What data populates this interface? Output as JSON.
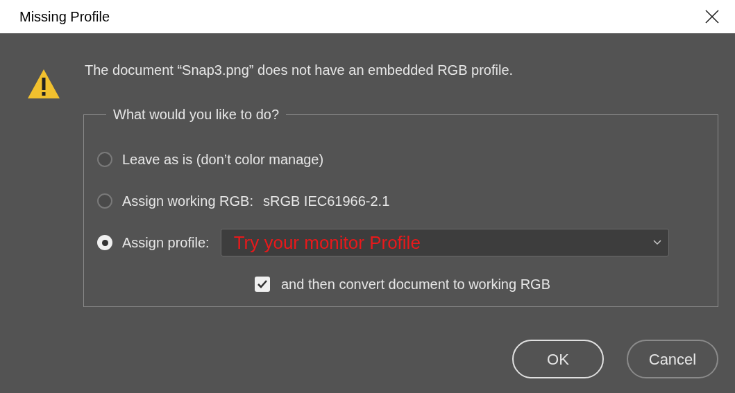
{
  "window": {
    "title": "Missing Profile"
  },
  "message": "The document “Snap3.png” does not have an embedded RGB profile.",
  "group": {
    "legend": "What would you like to do?"
  },
  "options": [
    {
      "kind": "plain",
      "label": "Leave as is (don’t color manage)",
      "selected": false
    },
    {
      "kind": "detail",
      "label": "Assign working RGB:",
      "detail": "sRGB IEC61966-2.1",
      "selected": false
    },
    {
      "kind": "profile",
      "label": "Assign profile:",
      "selected": true
    }
  ],
  "profile_dropdown": {
    "value": "Try your monitor Profile"
  },
  "convert_checkbox": {
    "label": "and then convert document to working RGB",
    "checked": true
  },
  "buttons": [
    "OK",
    "Cancel"
  ]
}
